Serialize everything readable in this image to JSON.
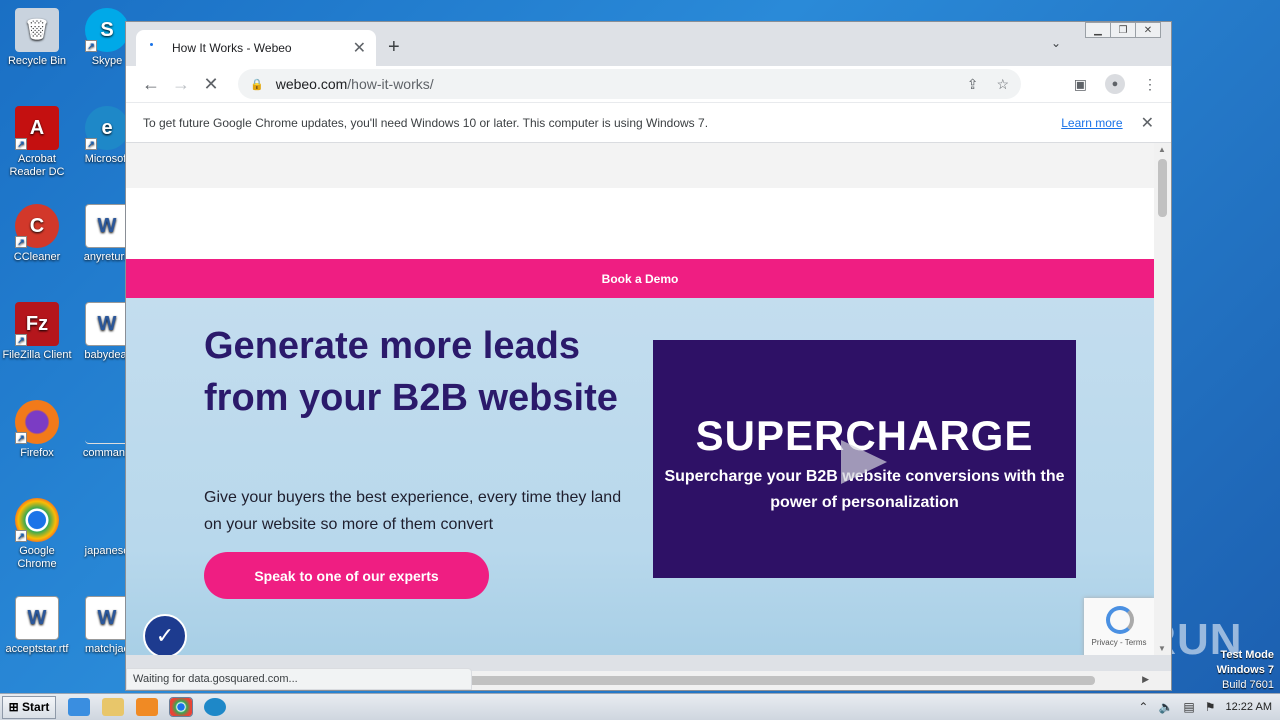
{
  "desktop": {
    "icons": [
      {
        "label": "Recycle Bin",
        "icon": "recycle-bin-icon"
      },
      {
        "label": "Skype",
        "icon": "skype-icon"
      },
      {
        "label": "Acrobat Reader DC",
        "icon": "acrobat-icon"
      },
      {
        "label": "Microsoft",
        "icon": "edge-icon"
      },
      {
        "label": "CCleaner",
        "icon": "ccleaner-icon"
      },
      {
        "label": "anyreturn",
        "icon": "word-doc-icon"
      },
      {
        "label": "FileZilla Client",
        "icon": "filezilla-icon"
      },
      {
        "label": "babydeat",
        "icon": "word-doc-icon"
      },
      {
        "label": "Firefox",
        "icon": "firefox-icon"
      },
      {
        "label": "command",
        "icon": "blank-file-icon"
      },
      {
        "label": "Google Chrome",
        "icon": "chrome-icon"
      },
      {
        "label": "japanese",
        "icon": "blank-file-icon"
      },
      {
        "label": "acceptstar.rtf",
        "icon": "word-doc-icon"
      },
      {
        "label": "matchjac",
        "icon": "word-doc-icon"
      }
    ]
  },
  "browser": {
    "tab_title": "How It Works - Webeo",
    "tab_close": "✕",
    "new_tab": "+",
    "url_host": "webeo.com",
    "url_path": "/how-it-works/",
    "infobar_message": "To get future Google Chrome updates, you'll need Windows 10 or later. This computer is using Windows 7.",
    "infobar_link": "Learn more",
    "status_text": "Waiting for data.gosquared.com..."
  },
  "page": {
    "book_demo": "Book a Demo",
    "headline": "Generate more leads from your B2B website",
    "subtext": "Give your buyers the best experience, every time they land on your website so more of them convert",
    "cta": "Speak to one of our experts",
    "video_title": "SUPERCHARGE",
    "video_subtitle": "Supercharge your B2B website conversions with the power of personalization",
    "recaptcha_text": "Privacy - Terms"
  },
  "taskbar": {
    "start_label": "Start",
    "clock": "12:22 AM"
  },
  "watermark": {
    "line1": "Test Mode",
    "line2": "Windows 7",
    "line3": "Build 7601",
    "brand": "ANY.RUN"
  },
  "colors": {
    "accent_pink": "#ef1e82",
    "headline_purple": "#2b1a6b",
    "video_bg": "#2e1166"
  }
}
